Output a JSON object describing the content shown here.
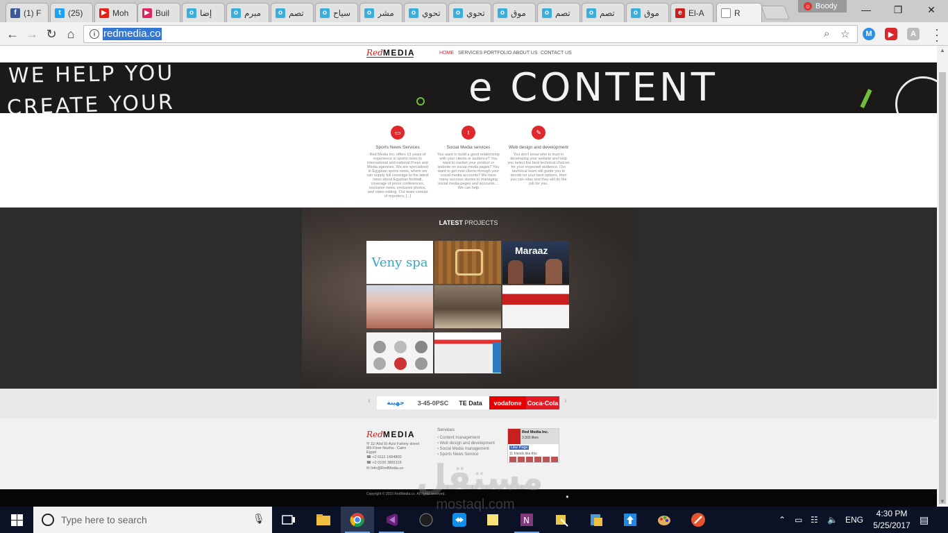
{
  "tabs": [
    {
      "label": "(1) F",
      "favicon": "facebook-icon",
      "color": "#3b5998",
      "glyph": "f"
    },
    {
      "label": "(25)",
      "favicon": "twitter-icon",
      "color": "#1da1f2",
      "glyph": "t"
    },
    {
      "label": "Moh",
      "favicon": "youtube-icon",
      "color": "#e62117",
      "glyph": "▶"
    },
    {
      "label": "Buil",
      "favicon": "builder-icon",
      "color": "#e0245e",
      "glyph": "▶"
    },
    {
      "label": "إضا",
      "favicon": "site-icon",
      "color": "#3ab0e2",
      "glyph": "o"
    },
    {
      "label": "مبرم",
      "favicon": "site-icon",
      "color": "#3ab0e2",
      "glyph": "o"
    },
    {
      "label": "تصم",
      "favicon": "site-icon",
      "color": "#3ab0e2",
      "glyph": "o"
    },
    {
      "label": "سياح",
      "favicon": "site-icon",
      "color": "#3ab0e2",
      "glyph": "o"
    },
    {
      "label": "مشر",
      "favicon": "site-icon",
      "color": "#3ab0e2",
      "glyph": "o"
    },
    {
      "label": "تحوي",
      "favicon": "site-icon",
      "color": "#3ab0e2",
      "glyph": "o"
    },
    {
      "label": "تحوي",
      "favicon": "site-icon",
      "color": "#3ab0e2",
      "glyph": "o"
    },
    {
      "label": "موق",
      "favicon": "site-icon",
      "color": "#3ab0e2",
      "glyph": "o"
    },
    {
      "label": "تصم",
      "favicon": "site-icon",
      "color": "#3ab0e2",
      "glyph": "o"
    },
    {
      "label": "تصم",
      "favicon": "site-icon",
      "color": "#3ab0e2",
      "glyph": "o"
    },
    {
      "label": "موق",
      "favicon": "site-icon",
      "color": "#3ab0e2",
      "glyph": "o"
    },
    {
      "label": "El-A",
      "favicon": "elahly-icon",
      "color": "#c8201f",
      "glyph": "e"
    },
    {
      "label": "R",
      "favicon": "page-icon",
      "color": "#ffffff",
      "glyph": ""
    }
  ],
  "profile": {
    "name": "Boody"
  },
  "address": {
    "url": "redmedia.co"
  },
  "site": {
    "logo_red": "Red",
    "logo_black": "MEDIA",
    "nav": [
      "HOME",
      "SERVICES",
      "PORTFOLIO",
      "ABOUT US",
      "CONTACT US"
    ],
    "hero": {
      "line1": "WE HELP YOU",
      "line2": "CREATE YOUR",
      "line3": "e CONTENT"
    },
    "services": [
      {
        "icon": "monitor-icon",
        "title": "Sports News Services",
        "text": "Red Media Inc. offers 13 years of experience in sports news to international and national Press and Media agencies. We are specialized in Egyptian sports news, where we can supply full coverage to the latest news about Egyptian football, coverage of press conferences, exclusive news, exclusive photos, and video editing. Our team consist of reporters, [...]"
      },
      {
        "icon": "twitter-icon",
        "title": "Social Media services",
        "text": "You want to build a good relationship with your clients or audience? You want to market your product or website on social media pages? You want to get new clients through your social media accounts? We have many success stories in managing social media pages and accounts.... We can help"
      },
      {
        "icon": "edit-icon",
        "title": "Web design and development",
        "text": "You don't know who to trust in developing your website and help you select the best technical choices for your expected audience. Our technical team will guide you to decide on your best options, then you can relax and they will do the job for you."
      }
    ],
    "projects": {
      "title_bold": "LATEST",
      "title_light": "PROJECTS",
      "thumb_veny": "Veny spa",
      "thumb_maraaz": "Maraaz"
    },
    "clients": [
      {
        "label": "جهينة",
        "bg": "#ffffff",
        "fg": "#2a7bc2"
      },
      {
        "label": "3-45-0PSC",
        "bg": "#ffffff",
        "fg": "#555555"
      },
      {
        "label": "TE Data",
        "bg": "#ffffff",
        "fg": "#222222"
      },
      {
        "label": "vodafone",
        "bg": "#e60000",
        "fg": "#ffffff"
      },
      {
        "label": "Coca-Cola",
        "bg": "#e21a23",
        "fg": "#ffffff"
      }
    ],
    "footer": {
      "address_lines": [
        "11/ Abd El-Aziz Fahmy street",
        "8th Floor Nozha - Cairo",
        "Egypt"
      ],
      "phone1": "+2 0111 1684800",
      "phone2": "+2 0100 3891119",
      "email": "Info@RedMedia.co",
      "services_title": "Services",
      "services": [
        "Content management",
        "Web design and development",
        "Social Media management",
        "Sports News Service"
      ],
      "fb_page": "Red Media Inc.",
      "fb_likes": "3,303 likes",
      "fb_like_btn": "Like Page",
      "fb_friends": "11 friends like this"
    },
    "copyright": "Copyright © 2016 RedMedia.co. All rights reserved."
  },
  "watermark": {
    "arabic": "مستقل",
    "latin": "mostaql.com"
  },
  "taskbar": {
    "search_placeholder": "Type here to search",
    "language": "ENG",
    "time": "4:30 PM",
    "date": "5/25/2017"
  }
}
